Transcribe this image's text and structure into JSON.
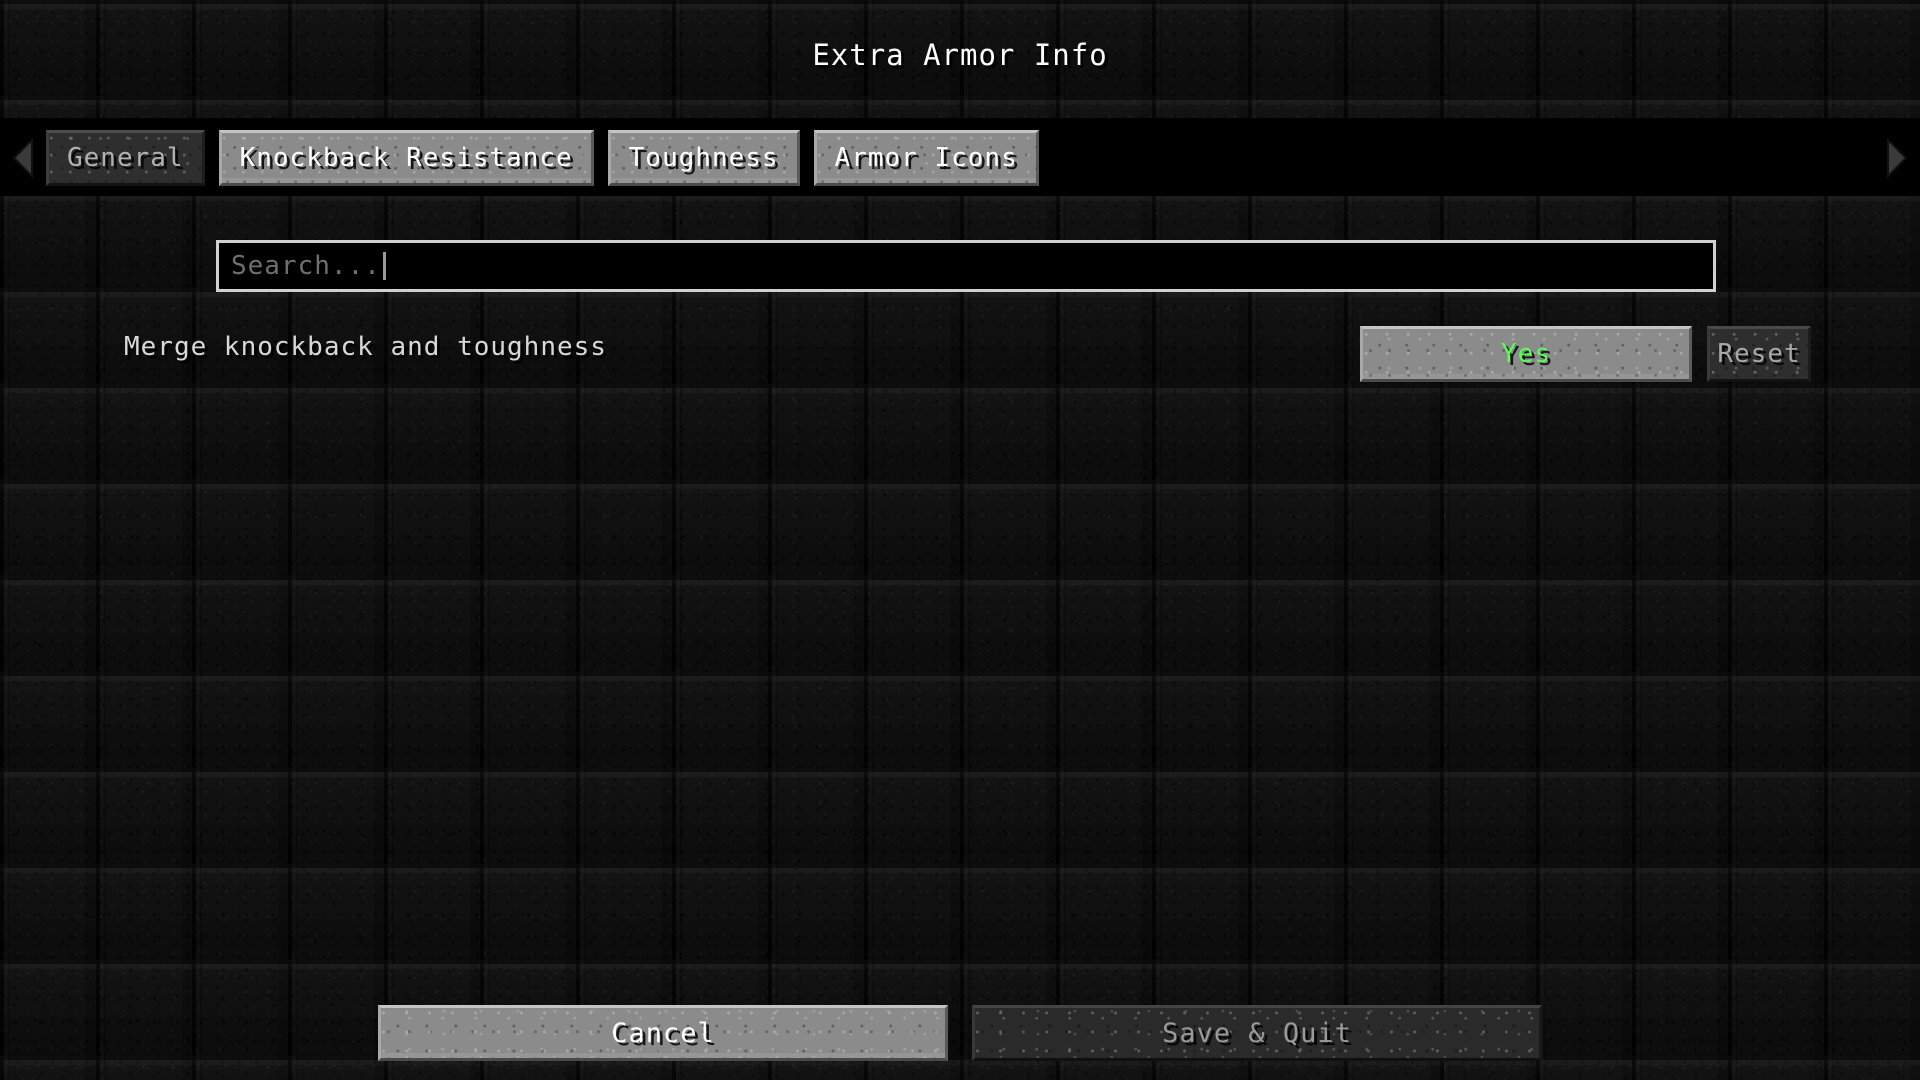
{
  "window": {
    "title": "Extra Armor Info"
  },
  "tabbar": {
    "prev_icon": "left-arrow-icon",
    "next_icon": "right-arrow-icon",
    "tabs": [
      {
        "label": "General",
        "state": "current"
      },
      {
        "label": "Knockback Resistance",
        "state": "available"
      },
      {
        "label": "Toughness",
        "state": "available"
      },
      {
        "label": "Armor Icons",
        "state": "available"
      }
    ]
  },
  "search": {
    "placeholder": "Search...",
    "value": ""
  },
  "options": [
    {
      "label": "Merge knockback and toughness",
      "value": "Yes",
      "reset_label": "Reset"
    }
  ],
  "footer": {
    "cancel_label": "Cancel",
    "save_label": "Save & Quit"
  },
  "colors": {
    "value_true": "#55ff55",
    "text_primary": "#ffffff",
    "text_muted": "#9a9a9a",
    "button_light": "#8b8b8b",
    "button_dark": "#2e2e2e",
    "background": "#0d0d0d"
  }
}
